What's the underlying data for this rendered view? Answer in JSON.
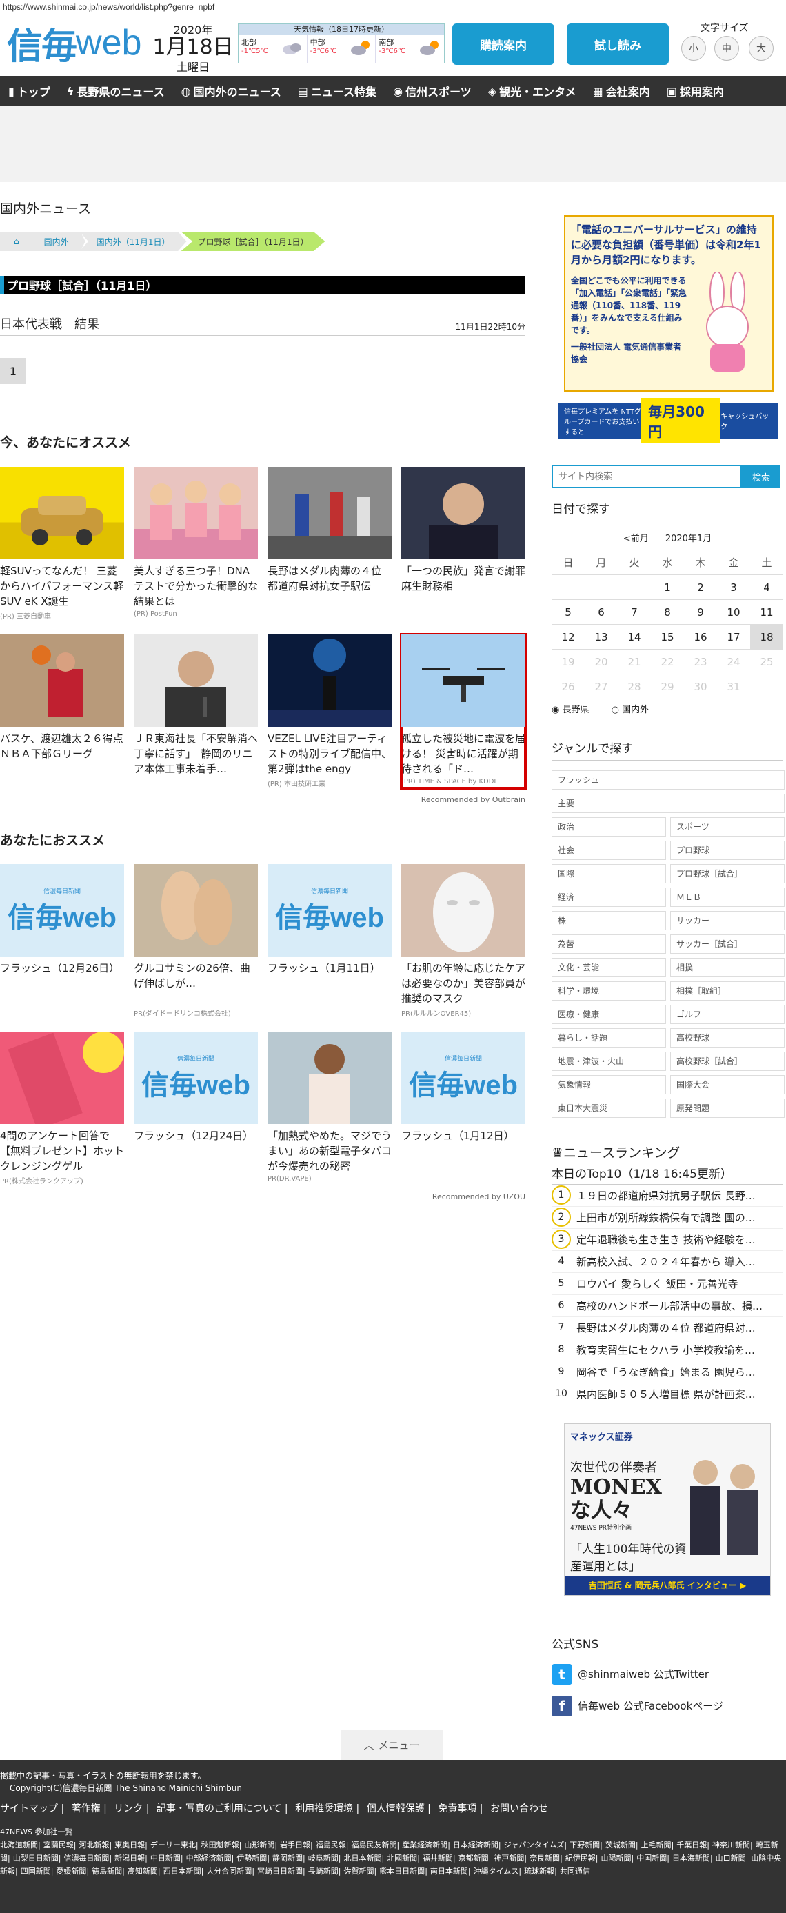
{
  "url": "https://www.shinmai.co.jp/news/world/list.php?genre=npbf",
  "header": {
    "logo_main": "信毎",
    "logo_web": "web",
    "year": "2020年",
    "month_day": "1月18日",
    "weekday": "土曜日",
    "weather_title": "天気情報（18日17時更新）",
    "weather": [
      {
        "area": "北部",
        "temp": "-1℃5℃"
      },
      {
        "area": "中部",
        "temp": "-3℃6℃"
      },
      {
        "area": "南部",
        "temp": "-3℃6℃"
      }
    ],
    "subscribe_label": "購読案内",
    "trial_label": "試し読み",
    "font_size_label": "文字サイズ",
    "font_small": "小",
    "font_medium": "中",
    "font_large": "大"
  },
  "nav": [
    "トップ",
    "長野県のニュース",
    "国内外のニュース",
    "ニュース特集",
    "信州スポーツ",
    "観光・エンタメ",
    "会社案内",
    "採用案内"
  ],
  "main": {
    "section_title": "国内外ニュース",
    "breadcrumb": [
      "国内外",
      "国内外（11月1日）",
      "プロ野球［試合］（11月1日）"
    ],
    "genre_bar": "プロ野球［試合］（11月1日）",
    "article_title": "日本代表戦　結果",
    "article_time": "11月1日22時10分",
    "page_number": "1",
    "rec_title": "今、あなたにオススメ",
    "rec_cards": [
      {
        "title": "軽SUVってなんだ！ 三菱からハイパフォーマンス軽SUV eK X誕生",
        "pr": "(PR) 三菱自動車"
      },
      {
        "title": "美人すぎる三つ子！DNAテストで分かった衝撃的な結果とは",
        "pr": "(PR) PostFun"
      },
      {
        "title": "長野はメダル肉薄の４位　都道府県対抗女子駅伝",
        "pr": ""
      },
      {
        "title": "「一つの民族」発言で謝罪　麻生財務相",
        "pr": ""
      },
      {
        "title": "バスケ、渡辺雄太２６得点　ＮＢＡ下部Ｇリーグ",
        "pr": ""
      },
      {
        "title": "ＪＲ東海社長「不安解消へ丁寧に話す」　静岡のリニア本体工事未着手…",
        "pr": ""
      },
      {
        "title": "VEZEL LIVE注目アーティストの特別ライブ配信中、第2弾はthe engy",
        "pr": "(PR) 本田技研工業"
      },
      {
        "title": "孤立した被災地に電波を届ける！ 災害時に活躍が期待される「ド…",
        "pr": "(PR) TIME & SPACE by KDDI"
      }
    ],
    "credit1": "Recommended by Outbrain",
    "rec2_title": "あなたにおススメ",
    "rec2_cards": [
      {
        "title": "フラッシュ（12月26日）",
        "pr": ""
      },
      {
        "title": "グルコサミンの26倍、曲げ伸ばしが…",
        "pr": "PR(ダイドードリンコ株式会社)"
      },
      {
        "title": "フラッシュ（1月11日）",
        "pr": ""
      },
      {
        "title": "「お肌の年齢に応じたケアは必要なのか」美容部員が推奨のマスク",
        "pr": "PR(ルルルンOVER45)"
      },
      {
        "title": "4問のアンケート回答で【無料プレゼント】ホットクレンジングゲル",
        "pr": "PR(株式会社ランクアップ)"
      },
      {
        "title": "フラッシュ（12月24日）",
        "pr": ""
      },
      {
        "title": "「加熱式やめた。マジでうまい」あの新型電子タバコが今爆売れの秘密",
        "pr": "PR(DR.VAPE)"
      },
      {
        "title": "フラッシュ（1月12日）",
        "pr": ""
      }
    ],
    "credit2": "Recommended by UZOU",
    "shinmai_thumb_sub": "信濃毎日新聞"
  },
  "sidebar": {
    "ad1_head": "「電話のユニバーサルサービス」の維持に必要な負担額（番号単価）は令和2年1月から月額2円になります。",
    "ad1_body": "全国どこでも公平に利用できる「加入電話」「公衆電話」「緊急通報（110番、118番、119番）」をみんなで支える仕組みです。",
    "ad1_org": "一般社団法人 電気通信事業者協会",
    "ad2_left": "信毎プレミアムを NTTグループカードでお支払いすると",
    "ad2_big": "毎月300円",
    "ad2_right": "キャッシュバック",
    "search_placeholder": "サイト内検索",
    "search_button": "検索",
    "date_search_title": "日付で探す",
    "cal_prev": "<前月",
    "cal_month": "2020年1月",
    "cal_dow": [
      "日",
      "月",
      "火",
      "水",
      "木",
      "金",
      "土"
    ],
    "cal_weeks": [
      [
        "",
        "",
        "",
        "1",
        "2",
        "3",
        "4"
      ],
      [
        "5",
        "6",
        "7",
        "8",
        "9",
        "10",
        "11"
      ],
      [
        "12",
        "13",
        "14",
        "15",
        "16",
        "17",
        "18"
      ],
      [
        "19",
        "20",
        "21",
        "22",
        "23",
        "24",
        "25"
      ],
      [
        "26",
        "27",
        "28",
        "29",
        "30",
        "31",
        ""
      ]
    ],
    "radio_nagano": "長野県",
    "radio_world": "国内外",
    "genre_title": "ジャンルで探す",
    "genres": [
      "フラッシュ",
      "主要",
      "政治",
      "スポーツ",
      "社会",
      "プロ野球",
      "国際",
      "プロ野球［試合］",
      "経済",
      "ＭＬＢ",
      "株",
      "サッカー",
      "為替",
      "サッカー［試合］",
      "文化・芸能",
      "相撲",
      "科学・環境",
      "相撲［取組］",
      "医療・健康",
      "ゴルフ",
      "暮らし・話題",
      "高校野球",
      "地震・津波・火山",
      "高校野球［試合］",
      "気象情報",
      "国際大会",
      "東日本大震災",
      "原発問題"
    ],
    "rank_title": "ニュースランキング",
    "rank_sub": "本日のTop10（1/18 16:45更新）",
    "ranking": [
      "１９日の都道府県対抗男子駅伝 長野…",
      "上田市が別所線鉄橋保有で調整 国の…",
      "定年退職後も生き生き 技術や経験を…",
      "新高校入試、２０２４年春から 導入…",
      "ロウバイ 愛らしく 飯田・元善光寺",
      "高校のハンドボール部活中の事故、損…",
      "長野はメダル肉薄の４位 都道府県対…",
      "教育実習生にセクハラ 小学校教諭を…",
      "岡谷で「うなぎ給食」始まる 園児ら…",
      "県内医師５０５人増目標 県が計画案…"
    ],
    "monex_logo": "マネックス証券",
    "monex_h1": "次世代の伴奏者",
    "monex_h2": "MONEXな人々",
    "monex_tag": "47NEWS PR特別企画",
    "monex_h3": "「人生100年時代の資産運用とは」",
    "monex_foot": "吉田恒氏 & 岡元兵八郎氏 インタビュー ▶",
    "sns_title": "公式SNS",
    "twitter": "@shinmaiweb 公式Twitter",
    "facebook": "信毎web 公式Facebookページ"
  },
  "menu_label": "メニュー",
  "footer": {
    "notice": "掲載中の記事・写真・イラストの無断転用を禁じます。",
    "copyright": "Copyright(C)信濃毎日新聞 The Shinano Mainichi Shimbun",
    "links": [
      "サイトマップ",
      "著作権",
      "リンク",
      "記事・写真のご利用について",
      "利用推奨環境",
      "個人情報保護",
      "免責事項",
      "お問い合わせ"
    ],
    "np_title": "47NEWS 参加社一覧",
    "newspapers": [
      "北海道新聞",
      "室蘭民報",
      "河北新報",
      "東奥日報",
      "デーリー東北",
      "秋田魁新報",
      "山形新聞",
      "岩手日報",
      "福島民報",
      "福島民友新聞",
      "産業経済新聞",
      "日本経済新聞",
      "ジャパンタイムズ",
      "下野新聞",
      "茨城新聞",
      "上毛新聞",
      "千葉日報",
      "神奈川新聞",
      "埼玉新聞",
      "山梨日日新聞",
      "信濃毎日新聞",
      "新潟日報",
      "中日新聞",
      "中部経済新聞",
      "伊勢新聞",
      "静岡新聞",
      "岐阜新聞",
      "北日本新聞",
      "北國新聞",
      "福井新聞",
      "京都新聞",
      "神戸新聞",
      "奈良新聞",
      "紀伊民報",
      "山陽新聞",
      "中国新聞",
      "日本海新聞",
      "山口新聞",
      "山陰中央新報",
      "四国新聞",
      "愛媛新聞",
      "徳島新聞",
      "高知新聞",
      "西日本新聞",
      "大分合同新聞",
      "宮崎日日新聞",
      "長崎新聞",
      "佐賀新聞",
      "熊本日日新聞",
      "南日本新聞",
      "沖縄タイムス",
      "琉球新報",
      "共同通信"
    ]
  },
  "colors": {
    "accent": "#1a9cd0",
    "nav": "#333333",
    "breadcrumb_active": "#b9e86c",
    "highlight": "#d40000"
  }
}
